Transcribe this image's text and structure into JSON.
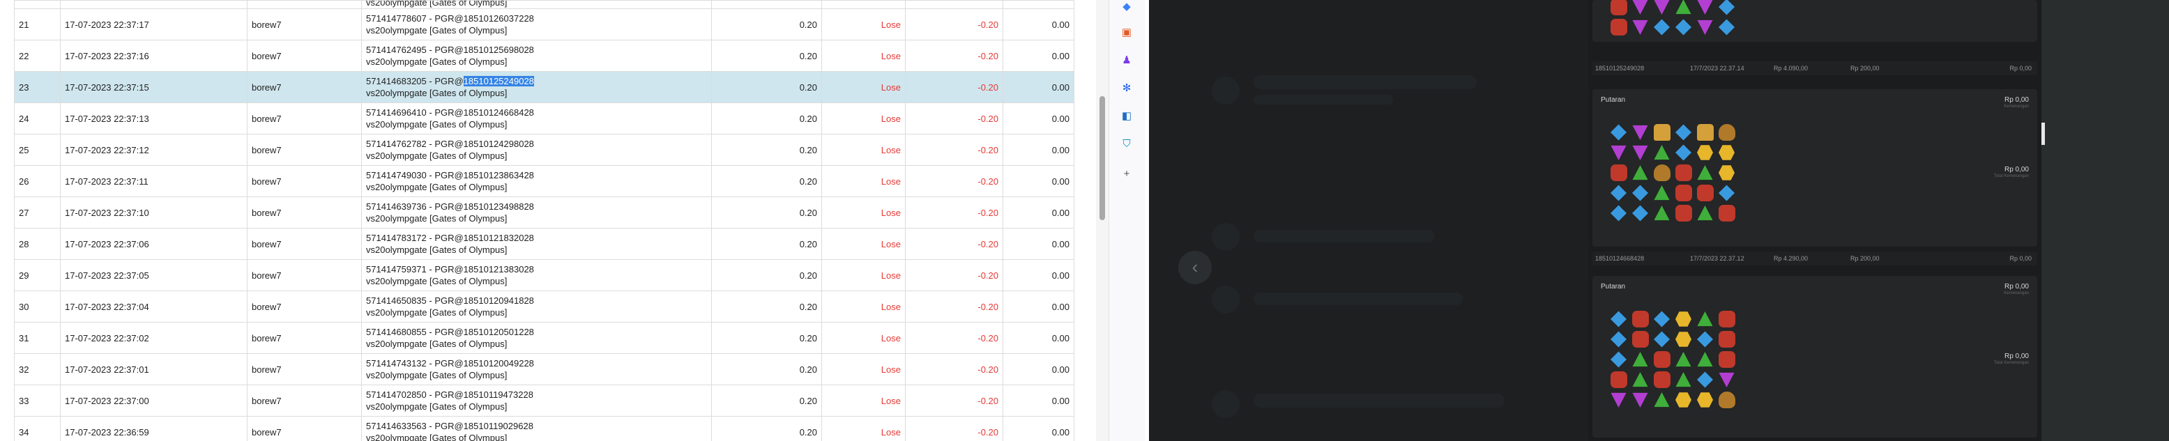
{
  "table": {
    "rows": [
      {
        "no": "",
        "date": "",
        "user": "",
        "ref1": "",
        "ref2": "vs20olympgate [Gates of Olympus]",
        "bet": "",
        "result": "",
        "win": "",
        "bal": ""
      },
      {
        "no": "21",
        "date": "17-07-2023 22:37:17",
        "user": "borew7",
        "ref1": "571414778607 - PGR@18510126037228",
        "ref2": "vs20olympgate [Gates of Olympus]",
        "bet": "0.20",
        "result": "Lose",
        "win": "-0.20",
        "bal": "0.00"
      },
      {
        "no": "22",
        "date": "17-07-2023 22:37:16",
        "user": "borew7",
        "ref1": "571414762495 - PGR@18510125698028",
        "ref2": "vs20olympgate [Gates of Olympus]",
        "bet": "0.20",
        "result": "Lose",
        "win": "-0.20",
        "bal": "0.00"
      },
      {
        "no": "23",
        "date": "17-07-2023 22:37:15",
        "user": "borew7",
        "ref1_prefix": "571414683205 - PGR@",
        "ref1_highlight": "18510125249028",
        "ref2": "vs20olympgate [Gates of Olympus]",
        "bet": "0.20",
        "result": "Lose",
        "win": "-0.20",
        "bal": "0.00",
        "selected": true
      },
      {
        "no": "24",
        "date": "17-07-2023 22:37:13",
        "user": "borew7",
        "ref1": "571414696410 - PGR@18510124668428",
        "ref2": "vs20olympgate [Gates of Olympus]",
        "bet": "0.20",
        "result": "Lose",
        "win": "-0.20",
        "bal": "0.00"
      },
      {
        "no": "25",
        "date": "17-07-2023 22:37:12",
        "user": "borew7",
        "ref1": "571414762782 - PGR@18510124298028",
        "ref2": "vs20olympgate [Gates of Olympus]",
        "bet": "0.20",
        "result": "Lose",
        "win": "-0.20",
        "bal": "0.00"
      },
      {
        "no": "26",
        "date": "17-07-2023 22:37:11",
        "user": "borew7",
        "ref1": "571414749030 - PGR@18510123863428",
        "ref2": "vs20olympgate [Gates of Olympus]",
        "bet": "0.20",
        "result": "Lose",
        "win": "-0.20",
        "bal": "0.00"
      },
      {
        "no": "27",
        "date": "17-07-2023 22:37:10",
        "user": "borew7",
        "ref1": "571414639736 - PGR@18510123498828",
        "ref2": "vs20olympgate [Gates of Olympus]",
        "bet": "0.20",
        "result": "Lose",
        "win": "-0.20",
        "bal": "0.00"
      },
      {
        "no": "28",
        "date": "17-07-2023 22:37:06",
        "user": "borew7",
        "ref1": "571414783172 - PGR@18510121832028",
        "ref2": "vs20olympgate [Gates of Olympus]",
        "bet": "0.20",
        "result": "Lose",
        "win": "-0.20",
        "bal": "0.00"
      },
      {
        "no": "29",
        "date": "17-07-2023 22:37:05",
        "user": "borew7",
        "ref1": "571414759371 - PGR@18510121383028",
        "ref2": "vs20olympgate [Gates of Olympus]",
        "bet": "0.20",
        "result": "Lose",
        "win": "-0.20",
        "bal": "0.00"
      },
      {
        "no": "30",
        "date": "17-07-2023 22:37:04",
        "user": "borew7",
        "ref1": "571414650835 - PGR@18510120941828",
        "ref2": "vs20olympgate [Gates of Olympus]",
        "bet": "0.20",
        "result": "Lose",
        "win": "-0.20",
        "bal": "0.00"
      },
      {
        "no": "31",
        "date": "17-07-2023 22:37:02",
        "user": "borew7",
        "ref1": "571414680855 - PGR@18510120501228",
        "ref2": "vs20olympgate [Gates of Olympus]",
        "bet": "0.20",
        "result": "Lose",
        "win": "-0.20",
        "bal": "0.00"
      },
      {
        "no": "32",
        "date": "17-07-2023 22:37:01",
        "user": "borew7",
        "ref1": "571414743132 - PGR@18510120049228",
        "ref2": "vs20olympgate [Gates of Olympus]",
        "bet": "0.20",
        "result": "Lose",
        "win": "-0.20",
        "bal": "0.00"
      },
      {
        "no": "33",
        "date": "17-07-2023 22:37:00",
        "user": "borew7",
        "ref1": "571414702850 - PGR@18510119473228",
        "ref2": "vs20olympgate [Gates of Olympus]",
        "bet": "0.20",
        "result": "Lose",
        "win": "-0.20",
        "bal": "0.00"
      },
      {
        "no": "34",
        "date": "17-07-2023 22:36:59",
        "user": "borew7",
        "ref1": "571414633563 - PGR@18510119029628",
        "ref2": "vs20olympgate [Gates of Olympus]",
        "bet": "0.20",
        "result": "Lose",
        "win": "-0.20",
        "bal": "0.00"
      }
    ]
  },
  "sidebar": {
    "icons": [
      {
        "name": "tag-icon",
        "glyph": "◆",
        "color": "#3b82f6"
      },
      {
        "name": "toolbox-icon",
        "glyph": "▣",
        "color": "#e05a2a"
      },
      {
        "name": "person-icon",
        "glyph": "♟",
        "color": "#7c3aed"
      },
      {
        "name": "copilot-icon",
        "glyph": "✻",
        "color": "#2563eb"
      },
      {
        "name": "outlook-icon",
        "glyph": "◧",
        "color": "#1d6fc4"
      },
      {
        "name": "shopping-icon",
        "glyph": "⛉",
        "color": "#0e8fbf"
      },
      {
        "name": "add-icon",
        "glyph": "+",
        "color": "#555555"
      }
    ]
  },
  "history": {
    "arrow": "‹",
    "rows": [
      {
        "id": "18510125249028",
        "date": "17/7/2023 22.37.14",
        "balance": "Rp 4.090,00",
        "bet": "Rp 200,00",
        "win": "Rp 0,00"
      },
      {
        "id": "18510124668428",
        "date": "17/7/2023 22.37.12",
        "balance": "Rp 4.290,00",
        "bet": "Rp 200,00",
        "win": "Rp 0,00"
      }
    ],
    "cards": [
      {
        "label": "Putaran",
        "amount": "Rp 0,00",
        "amount_sub": "Kemenangan",
        "total": "Rp 0,00",
        "total_sub": "Total Kemenangan",
        "grid": [
          [
            "dia",
            "vtri",
            "crn",
            "dia",
            "crn",
            "cup"
          ],
          [
            "vtri",
            "vtri",
            "tri",
            "dia",
            "hex",
            "hex"
          ],
          [
            "oct",
            "tri",
            "cup",
            "oct",
            "tri",
            "hex"
          ],
          [
            "dia",
            "dia",
            "tri",
            "oct",
            "oct",
            "dia"
          ],
          [
            "dia",
            "dia",
            "tri",
            "oct",
            "tri",
            "oct"
          ]
        ]
      },
      {
        "label": "Putaran",
        "amount": "Rp 0,00",
        "amount_sub": "Kemenangan",
        "total": "Rp 0,00",
        "total_sub": "Total Kemenangan",
        "grid": [
          [
            "dia",
            "oct",
            "dia",
            "hex",
            "tri",
            "oct"
          ],
          [
            "dia",
            "oct",
            "dia",
            "hex",
            "dia",
            "oct"
          ],
          [
            "dia",
            "tri",
            "oct",
            "tri",
            "tri",
            "oct"
          ],
          [
            "oct",
            "tri",
            "oct",
            "tri",
            "dia",
            "vtri"
          ],
          [
            "vtri",
            "vtri",
            "tri",
            "hex",
            "hex",
            "cup"
          ]
        ]
      }
    ],
    "top_grid": [
      [
        "oct",
        "vtri",
        "vtri",
        "tri",
        "vtri",
        "dia"
      ],
      [
        "oct",
        "vtri",
        "dia",
        "dia",
        "vtri",
        "dia"
      ]
    ]
  }
}
